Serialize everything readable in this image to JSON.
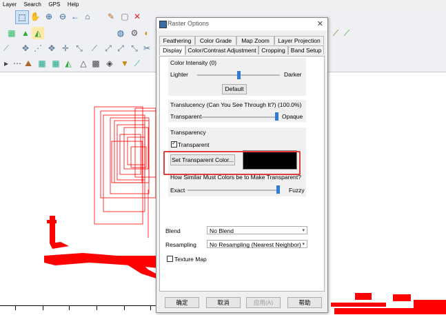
{
  "menubar": {
    "items": [
      "Layer",
      "Search",
      "GPS",
      "Help"
    ]
  },
  "dialog": {
    "title": "Raster Options",
    "tabs_row1": [
      "Feathering",
      "Color Grade",
      "Map Zoom",
      "Layer Projection"
    ],
    "tabs_row2": [
      "Display",
      "Color/Contrast Adjustment",
      "Cropping",
      "Band Setup"
    ],
    "active_tab": "Display",
    "color_intensity": {
      "label": "Color Intensity (0)",
      "left_label": "Lighter",
      "right_label": "Darker",
      "value_fraction": 0.5,
      "default_button": "Default"
    },
    "translucency": {
      "label": "Translucency (Can You See Through It?) (100.0%)",
      "left_label": "Transparent",
      "right_label": "Opaque",
      "value_fraction": 1.0
    },
    "transparency": {
      "group_label": "Transparency",
      "checkbox_label": "Transparent",
      "checked": true,
      "set_color_button": "Set Transparent Color...",
      "color": "#000000",
      "similarity_label": "How Similar Must Colors be to Make Transparent?",
      "left_label": "Exact",
      "right_label": "Fuzzy",
      "value_fraction": 1.0
    },
    "blend": {
      "label": "Blend",
      "value": "No Blend"
    },
    "resampling": {
      "label": "Resampling",
      "value": "No Resampling (Nearest Neighbor)"
    },
    "texture_map": {
      "label": "Texture Map",
      "checked": false
    },
    "buttons": {
      "ok": "确定",
      "cancel": "取消",
      "apply": "应用(A)",
      "help": "帮助"
    }
  },
  "colors": {
    "accent": "#2f7ad6",
    "highlight": "#e23b3b",
    "map_feature": "#ff0000"
  }
}
